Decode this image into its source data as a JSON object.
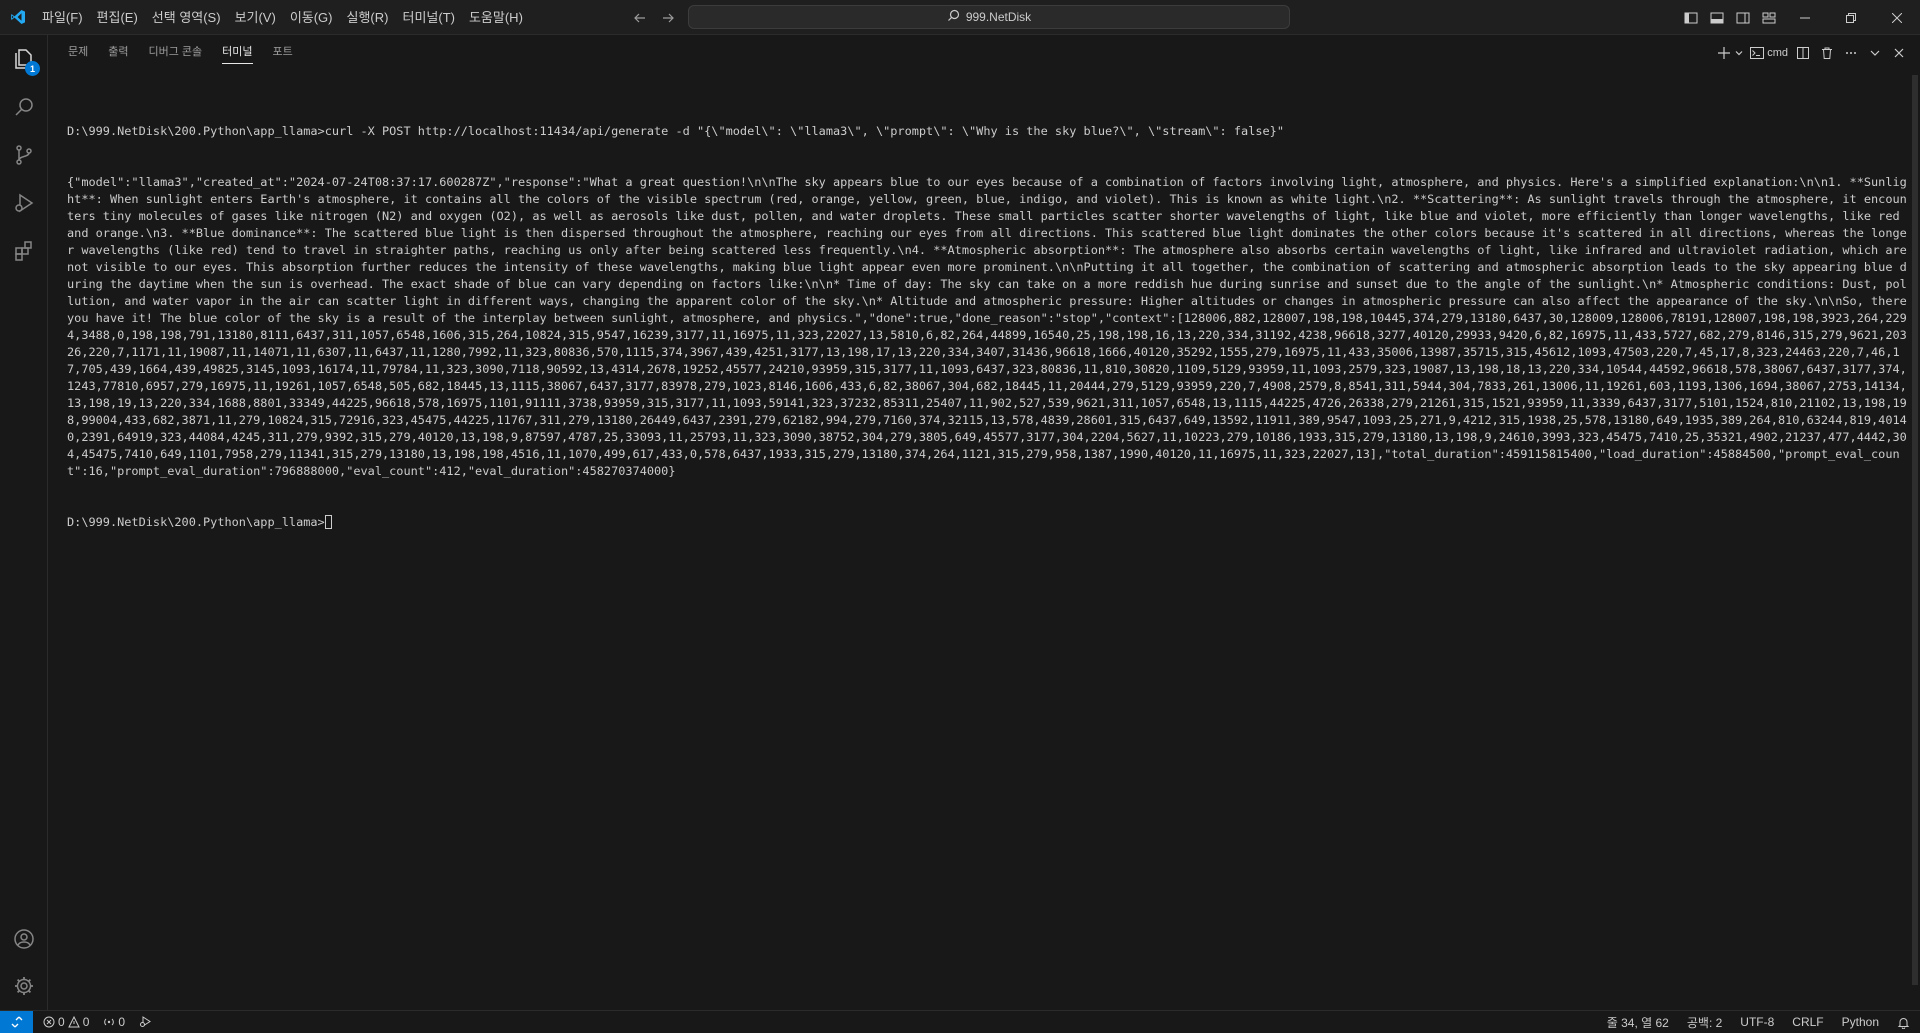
{
  "menu": [
    "파일(F)",
    "편집(E)",
    "선택 영역(S)",
    "보기(V)",
    "이동(G)",
    "실행(R)",
    "터미널(T)",
    "도움말(H)"
  ],
  "command_center": {
    "label": "999.NetDisk"
  },
  "activity": {
    "explorer_badge": "1"
  },
  "panel": {
    "tabs": [
      "문제",
      "출력",
      "디버그 콘솔",
      "터미널",
      "포트"
    ],
    "active_tab": "터미널",
    "shell_label": "cmd"
  },
  "terminal": {
    "lines": [
      "D:\\999.NetDisk\\200.Python\\app_llama>curl -X POST http://localhost:11434/api/generate -d \"{\\\"model\\\": \\\"llama3\\\", \\\"prompt\\\": \\\"Why is the sky blue?\\\", \\\"stream\\\": false}\"",
      "{\"model\":\"llama3\",\"created_at\":\"2024-07-24T08:37:17.600287Z\",\"response\":\"What a great question!\\n\\nThe sky appears blue to our eyes because of a combination of factors involving light, atmosphere, and physics. Here's a simplified explanation:\\n\\n1. **Sunlight**: When sunlight enters Earth's atmosphere, it contains all the colors of the visible spectrum (red, orange, yellow, green, blue, indigo, and violet). This is known as white light.\\n2. **Scattering**: As sunlight travels through the atmosphere, it encounters tiny molecules of gases like nitrogen (N2) and oxygen (O2), as well as aerosols like dust, pollen, and water droplets. These small particles scatter shorter wavelengths of light, like blue and violet, more efficiently than longer wavelengths, like red and orange.\\n3. **Blue dominance**: The scattered blue light is then dispersed throughout the atmosphere, reaching our eyes from all directions. This scattered blue light dominates the other colors because it's scattered in all directions, whereas the longer wavelengths (like red) tend to travel in straighter paths, reaching us only after being scattered less frequently.\\n4. **Atmospheric absorption**: The atmosphere also absorbs certain wavelengths of light, like infrared and ultraviolet radiation, which are not visible to our eyes. This absorption further reduces the intensity of these wavelengths, making blue light appear even more prominent.\\n\\nPutting it all together, the combination of scattering and atmospheric absorption leads to the sky appearing blue during the daytime when the sun is overhead. The exact shade of blue can vary depending on factors like:\\n\\n* Time of day: The sky can take on a more reddish hue during sunrise and sunset due to the angle of the sunlight.\\n* Atmospheric conditions: Dust, pollution, and water vapor in the air can scatter light in different ways, changing the apparent color of the sky.\\n* Altitude and atmospheric pressure: Higher altitudes or changes in atmospheric pressure can also affect the appearance of the sky.\\n\\nSo, there you have it! The blue color of the sky is a result of the interplay between sunlight, atmosphere, and physics.\",\"done\":true,\"done_reason\":\"stop\",\"context\":[128006,882,128007,198,198,10445,374,279,13180,6437,30,128009,128006,78191,128007,198,198,3923,264,2294,3488,0,198,198,791,13180,8111,6437,311,1057,6548,1606,315,264,10824,315,9547,16239,3177,11,16975,11,323,22027,13,5810,6,82,264,44899,16540,25,198,198,16,13,220,334,31192,4238,96618,3277,40120,29933,9420,6,82,16975,11,433,5727,682,279,8146,315,279,9621,20326,220,7,1171,11,19087,11,14071,11,6307,11,6437,11,1280,7992,11,323,80836,570,1115,374,3967,439,4251,3177,13,198,17,13,220,334,3407,31436,96618,1666,40120,35292,1555,279,16975,11,433,35006,13987,35715,315,45612,1093,47503,220,7,45,17,8,323,24463,220,7,46,17,705,439,1664,439,49825,3145,1093,16174,11,79784,11,323,3090,7118,90592,13,4314,2678,19252,45577,24210,93959,315,3177,11,1093,6437,323,80836,11,810,30820,1109,5129,93959,11,1093,2579,323,19087,13,198,18,13,220,334,10544,44592,96618,578,38067,6437,3177,374,1243,77810,6957,279,16975,11,19261,1057,6548,505,682,18445,13,1115,38067,6437,3177,83978,279,1023,8146,1606,433,6,82,38067,304,682,18445,11,20444,279,5129,93959,220,7,4908,2579,8,8541,311,5944,304,7833,261,13006,11,19261,603,1193,1306,1694,38067,2753,14134,13,198,19,13,220,334,1688,8801,33349,44225,96618,578,16975,1101,91111,3738,93959,315,3177,11,1093,59141,323,37232,85311,25407,11,902,527,539,9621,311,1057,6548,13,1115,44225,4726,26338,279,21261,315,1521,93959,11,3339,6437,3177,5101,1524,810,21102,13,198,198,99004,433,682,3871,11,279,10824,315,72916,323,45475,44225,11767,311,279,13180,26449,6437,2391,279,62182,994,279,7160,374,32115,13,578,4839,28601,315,6437,649,13592,11911,389,9547,1093,25,271,9,4212,315,1938,25,578,13180,649,1935,389,264,810,63244,819,40140,2391,64919,323,44084,4245,311,279,9392,315,279,40120,13,198,9,87597,4787,25,33093,11,25793,11,323,3090,38752,304,279,3805,649,45577,3177,304,2204,5627,11,10223,279,10186,1933,315,279,13180,13,198,9,24610,3993,323,45475,7410,25,35321,4902,21237,477,4442,304,45475,7410,649,1101,7958,279,11341,315,279,13180,13,198,198,4516,11,1070,499,617,433,0,578,6437,1933,315,279,13180,374,264,1121,315,279,958,1387,1990,40120,11,16975,11,323,22027,13],\"total_duration\":459115815400,\"load_duration\":45884500,\"prompt_eval_count\":16,\"prompt_eval_duration\":796888000,\"eval_count\":412,\"eval_duration\":458270374000}",
      "D:\\999.NetDisk\\200.Python\\app_llama>"
    ]
  },
  "status": {
    "errors": "0",
    "warnings": "0",
    "ports": "0",
    "position": "줄 34, 열 62",
    "spaces": "공백: 2",
    "encoding": "UTF-8",
    "eol": "CRLF",
    "language": "Python"
  },
  "colors": {
    "accent": "#0078d4",
    "background": "#181818",
    "titlebar": "#1f1f1f"
  }
}
